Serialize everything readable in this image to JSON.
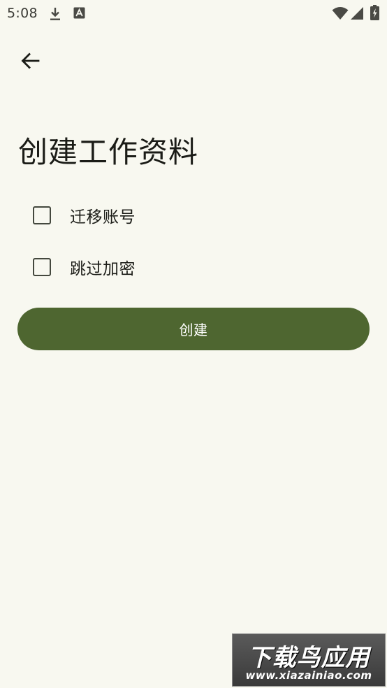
{
  "status_bar": {
    "time": "5:08",
    "icons": [
      "download-icon",
      "a-badge-icon",
      "wifi-icon",
      "signal-icon",
      "battery-charging-icon"
    ]
  },
  "header": {
    "back_icon": "arrow-left-icon"
  },
  "page": {
    "title": "创建工作资料"
  },
  "options": [
    {
      "label": "迁移账号",
      "checked": false
    },
    {
      "label": "跳过加密",
      "checked": false
    }
  ],
  "actions": {
    "create_label": "创建"
  },
  "watermark": {
    "title": "下载鸟应用",
    "url": "www.xiazainiao.com"
  },
  "colors": {
    "background": "#f8f8f0",
    "primary": "#4e6630",
    "on_primary": "#ffffff",
    "text": "#1b1c17",
    "outline": "#44483e"
  }
}
